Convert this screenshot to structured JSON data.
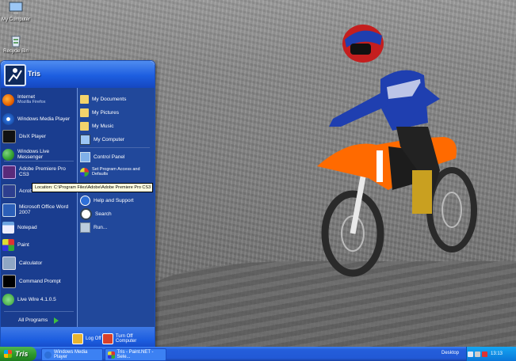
{
  "desktop": {
    "icons": [
      {
        "label": "My Computer",
        "icon": "my-computer-icon"
      },
      {
        "label": "Recycle Bin",
        "icon": "recycle-bin-icon"
      }
    ]
  },
  "start_menu": {
    "user_name": "Tris",
    "pinned": [
      {
        "title": "Internet",
        "subtitle": "Mozilla Firefox",
        "icon": "firefox-icon",
        "color": "#e66000"
      },
      {
        "title": "Windows Media Player",
        "subtitle": "",
        "icon": "media-player-icon",
        "color": "#2d6fd8"
      },
      {
        "title": "DivX Player",
        "subtitle": "",
        "icon": "divx-icon",
        "color": "#111111"
      },
      {
        "title": "Windows Live Messenger",
        "subtitle": "",
        "icon": "messenger-icon",
        "color": "#3aa83a"
      }
    ],
    "recent": [
      {
        "title": "Adobe Premiere Pro CS3",
        "icon": "premiere-icon",
        "color": "#5a2a7a"
      },
      {
        "title": "Acrob...",
        "icon": "acrobat-icon",
        "color": "#2d3f8f"
      },
      {
        "title": "Microsoft Office Word 2007",
        "icon": "word-icon",
        "color": "#2b5fb8"
      },
      {
        "title": "Notepad",
        "icon": "notepad-icon",
        "color": "#6aa3e0"
      },
      {
        "title": "Paint",
        "icon": "paint-icon",
        "color": "#d8b04a"
      },
      {
        "title": "Calculator",
        "icon": "calculator-icon",
        "color": "#8fa6c4"
      },
      {
        "title": "Command Prompt",
        "icon": "command-prompt-icon",
        "color": "#000000"
      },
      {
        "title": "Live Wire 4.1.0.5",
        "icon": "limewire-icon",
        "color": "#2f9a2f"
      }
    ],
    "all_programs": "All Programs",
    "places": [
      {
        "title": "My Documents",
        "icon": "folder-icon"
      },
      {
        "title": "My Pictures",
        "icon": "folder-icon"
      },
      {
        "title": "My Music",
        "icon": "folder-icon"
      },
      {
        "title": "My Computer",
        "icon": "computer-icon"
      },
      {
        "title": "Control Panel",
        "icon": "control-panel-icon"
      },
      {
        "title": "Set Program Access and Defaults",
        "icon": "defaults-icon"
      },
      {
        "title": "Help and Support",
        "icon": "help-icon"
      },
      {
        "title": "Search",
        "icon": "search-icon"
      },
      {
        "title": "Run...",
        "icon": "run-icon"
      }
    ],
    "tooltip": "Location: C:\\Program Files\\Adobe\\Adobe Premiere Pro CS3",
    "footer": {
      "log_off": "Log Off",
      "turn_off": "Turn Off Computer"
    }
  },
  "taskbar": {
    "start_label": "Tris",
    "tasks": [
      {
        "label": "Windows Media Player",
        "icon": "media-player-icon"
      },
      {
        "label": "Tris - Paint.NET - Sele...",
        "icon": "paint-icon"
      }
    ],
    "desktop_label": "Desktop",
    "clock": "13:13"
  },
  "colors": {
    "taskbar": "#245edb",
    "start_button": "#2f9a2f",
    "bike_orange": "#ff6a00",
    "rider_blue": "#1f3fb0"
  }
}
